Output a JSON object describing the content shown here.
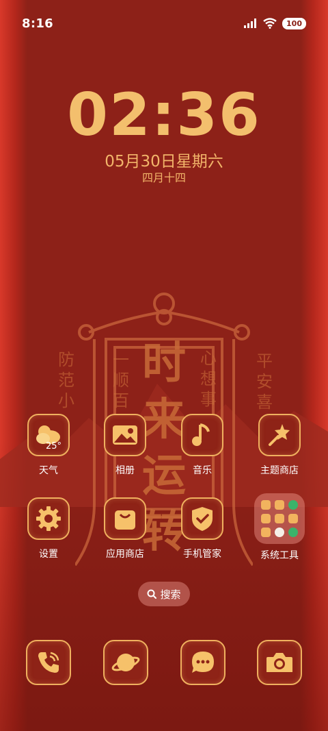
{
  "status_bar": {
    "time": "8:16",
    "battery": "100"
  },
  "lockscreen": {
    "clock": "02:36",
    "date": "05月30日星期六",
    "lunar_date": "四月十四"
  },
  "wallpaper": {
    "vertical_text": [
      "时",
      "来",
      "运",
      "转"
    ],
    "side_text_left": [
      "防",
      "范",
      "小"
    ],
    "side_text_mid_left": [
      "一",
      "顺",
      "百"
    ],
    "side_text_mid_right": [
      "心",
      "想",
      "事"
    ],
    "side_text_right": [
      "平",
      "安",
      "喜"
    ]
  },
  "apps_row1": [
    {
      "label": "天气",
      "icon": "weather-icon",
      "temp": "25°"
    },
    {
      "label": "相册",
      "icon": "gallery-icon"
    },
    {
      "label": "音乐",
      "icon": "music-icon"
    },
    {
      "label": "主题商店",
      "icon": "theme-store-icon"
    }
  ],
  "apps_row2": [
    {
      "label": "设置",
      "icon": "settings-icon"
    },
    {
      "label": "应用商店",
      "icon": "app-store-icon"
    },
    {
      "label": "手机管家",
      "icon": "phone-manager-icon"
    },
    {
      "label": "系统工具",
      "icon": "system-tools-folder"
    }
  ],
  "search": {
    "label": "搜索"
  },
  "dock": [
    {
      "icon": "phone-icon"
    },
    {
      "icon": "browser-icon"
    },
    {
      "icon": "messages-icon"
    },
    {
      "icon": "camera-icon"
    }
  ],
  "colors": {
    "background": "#8a2016",
    "gold": "#f0b15f",
    "accent_light": "#f3bf6d"
  }
}
